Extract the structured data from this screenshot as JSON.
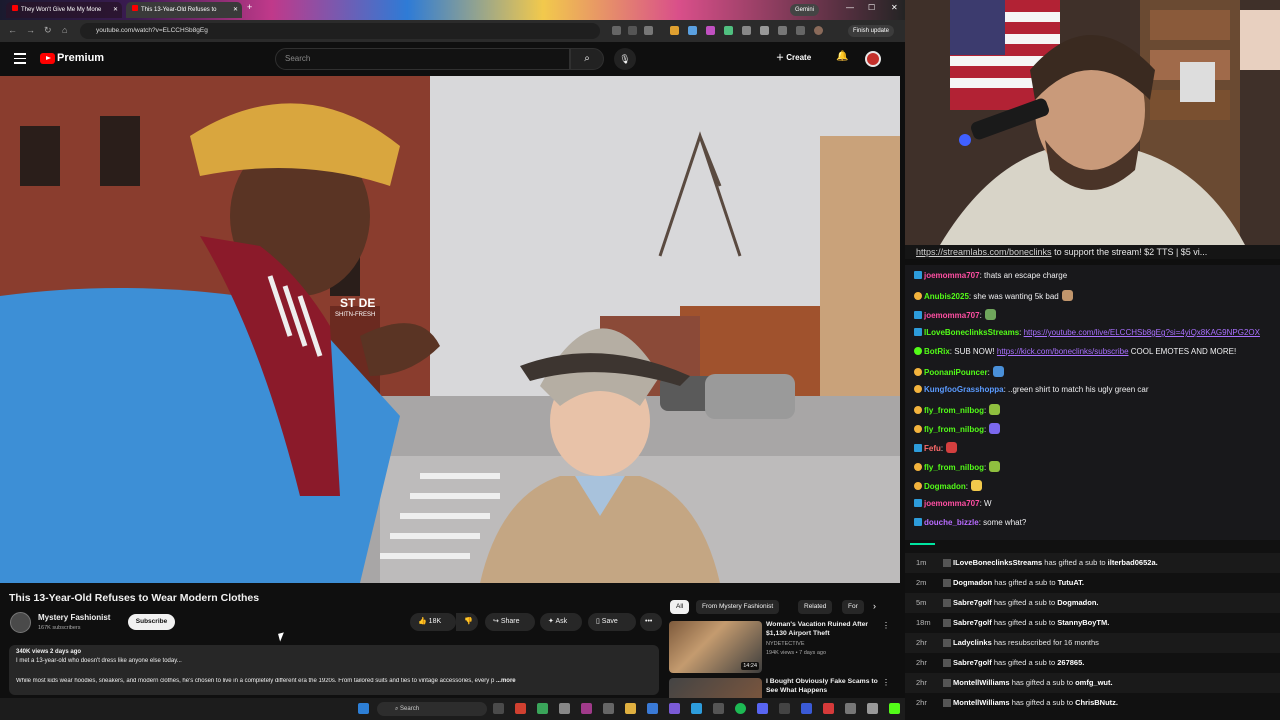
{
  "browser": {
    "tabs": [
      {
        "label": "They Won't Give Me My Mone"
      },
      {
        "label": "This 13-Year-Old Refuses to"
      }
    ],
    "new_tab": "+",
    "gemini": "Gemini",
    "url": "youtube.com/watch?v=ELCCHSb8gEg",
    "finish_update": "Finish update"
  },
  "youtube": {
    "brand": "Premium",
    "search_placeholder": "Search",
    "create_label": "Create"
  },
  "video": {
    "title": "This 13-Year-Old Refuses to Wear Modern Clothes",
    "channel": "Mystery Fashionist",
    "subscribers": "167K subscribers",
    "subscribe_label": "Subscribe",
    "likes": "18K",
    "share_label": "Share",
    "ask_label": "Ask",
    "save_label": "Save",
    "views_date": "340K views  2 days ago",
    "desc_line1": "I met a 13-year-old who doesn't dress like anyone else today...",
    "desc_line2": "While most kids wear hoodies, sneakers, and modern clothes, he's chosen to live in a completely different era the 1920s. From tailored suits and ties to vintage accessories, every p",
    "more_label": "...more",
    "sign_text": "ST DE",
    "sign_text2": "SHITN-FRESH"
  },
  "related": {
    "chips": [
      "All",
      "From Mystery Fashionist",
      "Related",
      "For"
    ],
    "items": [
      {
        "title": "Woman's Vacation Ruined After $1,130 Airport Theft",
        "channel": "NYDETECTIVE",
        "meta": "194K views • 7 days ago",
        "duration": "14:24"
      },
      {
        "title": "I Bought Obviously Fake Scams to See What Happens",
        "channel": "",
        "meta": "",
        "duration": ""
      }
    ]
  },
  "taskbar": {
    "search_label": "Search"
  },
  "stream": {
    "ticker_link": "https://streamlabs.com/boneclinks",
    "ticker_rest": " to support the stream! $2 TTS | $5 vi..."
  },
  "chat": [
    {
      "user": "joemomma707",
      "text": ": thats an escape charge",
      "user_color": "#ff4fa3",
      "badge": "k"
    },
    {
      "user": "Anubis2025",
      "text": ": she was wanting 5k bad",
      "user_color": "#53fc18",
      "badge": "o",
      "emote_color": "#c0956c"
    },
    {
      "user": "joemomma707",
      "text": ":",
      "user_color": "#ff4fa3",
      "badge": "k",
      "emote_color": "#6fa65c"
    },
    {
      "user": "ILoveBoneclinksStreams",
      "text": ": ",
      "user_color": "#53fc18",
      "badge": "k",
      "link": "https://youtube.com/live/ELCCHSb8gEg?si=4yiQx8KAG9NPG2OX"
    },
    {
      "user": "BotRix",
      "text": ": SUB NOW! ",
      "user_color": "#53fc18",
      "badge": "g",
      "link": "https://kick.com/boneclinks/subscribe",
      "tail": " COOL EMOTES AND MORE!"
    },
    {
      "user": "PoonaniPouncer",
      "text": ":",
      "user_color": "#53fc18",
      "badge": "o",
      "emote_color": "#4a90d9"
    },
    {
      "user": "KungfooGrasshoppa",
      "text": ": ..green shirt to match his ugly green car",
      "user_color": "#5b9bff",
      "badge": "o"
    },
    {
      "user": "fly_from_nilbog",
      "text": ":",
      "user_color": "#53fc18",
      "badge": "o",
      "emote_color": "#8fbf3f"
    },
    {
      "user": "fly_from_nilbog",
      "text": ":",
      "user_color": "#53fc18",
      "badge": "o",
      "emote_color": "#7b68ee"
    },
    {
      "user": "Fefu",
      "text": ":",
      "user_color": "#ff6b6b",
      "badge": "k",
      "emote_color": "#d43f3f"
    },
    {
      "user": "fly_from_nilbog",
      "text": ":",
      "user_color": "#53fc18",
      "badge": "o",
      "emote_color": "#8fbf3f"
    },
    {
      "user": "Dogmadon",
      "text": ":",
      "user_color": "#53fc18",
      "badge": "o",
      "emote_color": "#f2c94c"
    },
    {
      "user": "joemomma707",
      "text": ": W",
      "user_color": "#ff4fa3",
      "badge": "k"
    },
    {
      "user": "douche_bizzle",
      "text": ": some what?",
      "user_color": "#b86bff",
      "badge": "k"
    }
  ],
  "events": [
    {
      "time": "1m",
      "user": "ILoveBoneclinksStreams",
      "text": " has gifted a sub to ",
      "target": "ilterbad0652a."
    },
    {
      "time": "2m",
      "user": "Dogmadon",
      "text": " has gifted a sub to ",
      "target": "TutuAT."
    },
    {
      "time": "5m",
      "user": "Sabre7golf",
      "text": " has gifted a sub to ",
      "target": "Dogmadon."
    },
    {
      "time": "18m",
      "user": "Sabre7golf",
      "text": " has gifted a sub to ",
      "target": "StannyBoyTM."
    },
    {
      "time": "2hr",
      "user": "Ladyclinks",
      "text": " has resubscribed for 16 months",
      "target": ""
    },
    {
      "time": "2hr",
      "user": "Sabre7golf",
      "text": " has gifted a sub to ",
      "target": "267865."
    },
    {
      "time": "2hr",
      "user": "MontellWilliams",
      "text": " has gifted a sub to ",
      "target": "omfg_wut."
    },
    {
      "time": "2hr",
      "user": "MontellWilliams",
      "text": " has gifted a sub to ",
      "target": "ChrisBNutz."
    }
  ]
}
